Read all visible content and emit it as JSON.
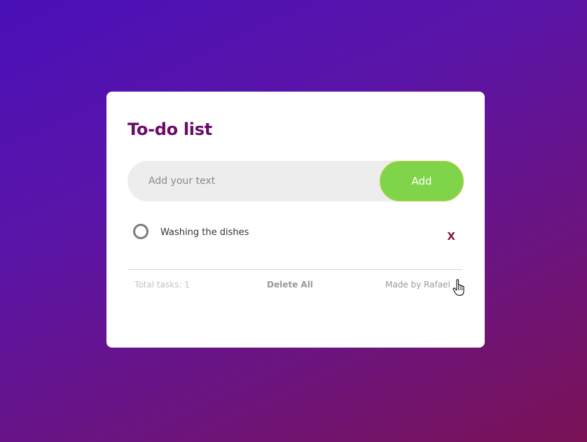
{
  "app": {
    "title": "To-do list"
  },
  "input": {
    "placeholder": "Add your text",
    "value": ""
  },
  "add_button": {
    "label": "Add"
  },
  "tasks": [
    {
      "text": "Washing the dishes",
      "completed": false,
      "delete_label": "X"
    }
  ],
  "footer": {
    "total_label": "Total tasks: 1",
    "delete_all_label": "Delete All",
    "credit_label": "Made by Rafael"
  },
  "colors": {
    "title": "#6a0b6b",
    "add_button": "#7fd44a",
    "delete_x": "#8a1a3a"
  },
  "icons": {
    "task_checkbox": "circle-unchecked-icon",
    "mouse_cursor": "hand-pointer-icon"
  }
}
